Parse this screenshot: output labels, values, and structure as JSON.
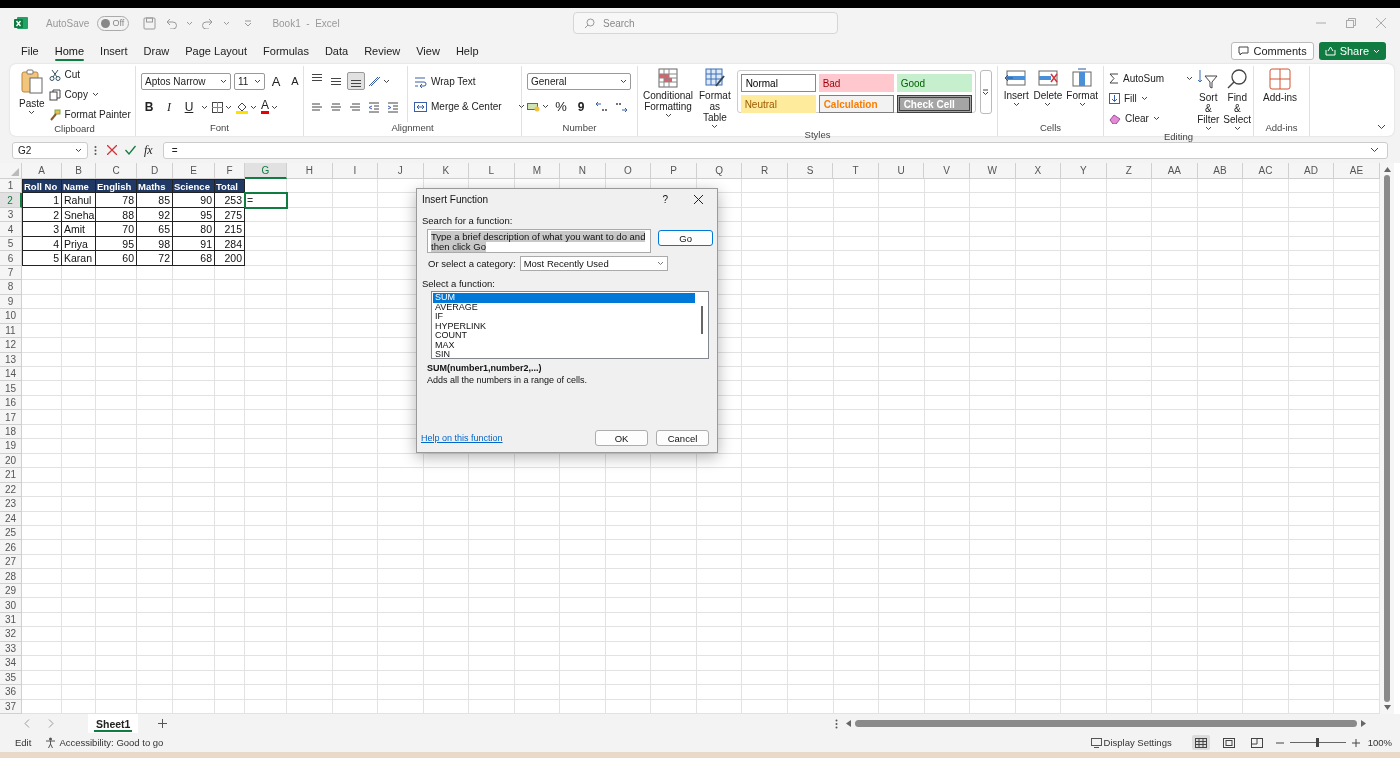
{
  "title_bar": {
    "autosave_label": "AutoSave",
    "autosave_toggle": {
      "label": "Off",
      "on": false
    },
    "title": "Book1  -  Excel",
    "search": {
      "placeholder": "Search"
    }
  },
  "menu_tabs": [
    {
      "label": "File",
      "selected": false
    },
    {
      "label": "Home",
      "selected": true
    },
    {
      "label": "Insert",
      "selected": false
    },
    {
      "label": "Draw",
      "selected": false
    },
    {
      "label": "Page Layout",
      "selected": false
    },
    {
      "label": "Formulas",
      "selected": false
    },
    {
      "label": "Data",
      "selected": false
    },
    {
      "label": "Review",
      "selected": false
    },
    {
      "label": "View",
      "selected": false
    },
    {
      "label": "Help",
      "selected": false
    }
  ],
  "header_buttons": {
    "comments": "Comments",
    "share": "Share"
  },
  "ribbon": {
    "clipboard": {
      "label": "Clipboard",
      "paste": "Paste",
      "cut": "Cut",
      "copy": "Copy",
      "format_painter": "Format Painter"
    },
    "font": {
      "label": "Font",
      "font_name": "Aptos Narrow",
      "font_size": "11",
      "grow_font": "A",
      "shrink_font": "A",
      "bold": "B",
      "italic": "I",
      "underline": "U",
      "font_color": "A"
    },
    "alignment": {
      "label": "Alignment",
      "vertical_align": [
        {
          "selected": false
        },
        {
          "selected": false
        },
        {
          "selected": true
        }
      ],
      "wrap_text": "Wrap Text",
      "merge_center": "Merge & Center"
    },
    "number": {
      "label": "Number",
      "format": "General",
      "percent": "%",
      "comma": "9"
    },
    "styles": {
      "label": "Styles",
      "conditional": "Conditional Formatting",
      "format_table": "Format as Table",
      "gallery": [
        {
          "label": "Normal",
          "kind": "normal"
        },
        {
          "label": "Bad",
          "kind": "bad"
        },
        {
          "label": "Good",
          "kind": "good"
        },
        {
          "label": "Neutral",
          "kind": "neutral"
        },
        {
          "label": "Calculation",
          "kind": "calculation"
        },
        {
          "label": "Check Cell",
          "kind": "check"
        }
      ]
    },
    "cells": {
      "label": "Cells",
      "insert": "Insert",
      "delete": "Delete",
      "format": "Format"
    },
    "editing": {
      "label": "Editing",
      "autosum": "AutoSum",
      "fill": "Fill",
      "clear": "Clear",
      "sort_filter": "Sort & Filter",
      "find_select": "Find & Select"
    },
    "addins": {
      "label": "Add-ins",
      "addins": "Add-ins"
    }
  },
  "formula_bar": {
    "name_box": "G2",
    "fx": "fx",
    "formula": "="
  },
  "sheet": {
    "columns": [
      {
        "label": "A",
        "selected": false
      },
      {
        "label": "B",
        "selected": false
      },
      {
        "label": "C",
        "selected": false
      },
      {
        "label": "D",
        "selected": false
      },
      {
        "label": "E",
        "selected": false
      },
      {
        "label": "F",
        "selected": false
      },
      {
        "label": "G",
        "selected": true
      },
      {
        "label": "H",
        "selected": false
      },
      {
        "label": "I",
        "selected": false
      },
      {
        "label": "J",
        "selected": false
      },
      {
        "label": "K",
        "selected": false
      },
      {
        "label": "L",
        "selected": false
      },
      {
        "label": "M",
        "selected": false
      },
      {
        "label": "N",
        "selected": false
      },
      {
        "label": "O",
        "selected": false
      },
      {
        "label": "P",
        "selected": false
      },
      {
        "label": "Q",
        "selected": false
      },
      {
        "label": "R",
        "selected": false
      },
      {
        "label": "S",
        "selected": false
      },
      {
        "label": "T",
        "selected": false
      },
      {
        "label": "U",
        "selected": false
      },
      {
        "label": "V",
        "selected": false
      },
      {
        "label": "W",
        "selected": false
      },
      {
        "label": "X",
        "selected": false
      },
      {
        "label": "Y",
        "selected": false
      },
      {
        "label": "Z",
        "selected": false
      },
      {
        "label": "AA",
        "selected": false
      },
      {
        "label": "AB",
        "selected": false
      },
      {
        "label": "AC",
        "selected": false
      },
      {
        "label": "AD",
        "selected": false
      },
      {
        "label": "AE",
        "selected": false
      }
    ],
    "rows": [
      {
        "label": "1",
        "selected": false
      },
      {
        "label": "2",
        "selected": true
      },
      {
        "label": "3",
        "selected": false
      },
      {
        "label": "4",
        "selected": false
      },
      {
        "label": "5",
        "selected": false
      },
      {
        "label": "6",
        "selected": false
      },
      {
        "label": "7",
        "selected": false
      },
      {
        "label": "8",
        "selected": false
      },
      {
        "label": "9",
        "selected": false
      },
      {
        "label": "10",
        "selected": false
      },
      {
        "label": "11",
        "selected": false
      },
      {
        "label": "12",
        "selected": false
      },
      {
        "label": "13",
        "selected": false
      },
      {
        "label": "14",
        "selected": false
      },
      {
        "label": "15",
        "selected": false
      },
      {
        "label": "16",
        "selected": false
      },
      {
        "label": "17",
        "selected": false
      },
      {
        "label": "18",
        "selected": false
      },
      {
        "label": "19",
        "selected": false
      },
      {
        "label": "20",
        "selected": false
      },
      {
        "label": "21",
        "selected": false
      },
      {
        "label": "22",
        "selected": false
      },
      {
        "label": "23",
        "selected": false
      },
      {
        "label": "24",
        "selected": false
      },
      {
        "label": "25",
        "selected": false
      },
      {
        "label": "26",
        "selected": false
      },
      {
        "label": "27",
        "selected": false
      },
      {
        "label": "28",
        "selected": false
      },
      {
        "label": "29",
        "selected": false
      },
      {
        "label": "30",
        "selected": false
      },
      {
        "label": "31",
        "selected": false
      },
      {
        "label": "32",
        "selected": false
      },
      {
        "label": "33",
        "selected": false
      },
      {
        "label": "34",
        "selected": false
      },
      {
        "label": "35",
        "selected": false
      },
      {
        "label": "36",
        "selected": false
      },
      {
        "label": "37",
        "selected": false
      }
    ],
    "active_cell_value": "=",
    "table": {
      "columns": [
        {
          "label": "Roll No",
          "kind": "number"
        },
        {
          "label": "Name",
          "kind": "text"
        },
        {
          "label": "English",
          "kind": "number"
        },
        {
          "label": "Maths",
          "kind": "number"
        },
        {
          "label": "Science",
          "kind": "number"
        },
        {
          "label": "Total",
          "kind": "number"
        }
      ],
      "rows": [
        [
          "1",
          "Rahul",
          "78",
          "85",
          "90",
          "253"
        ],
        [
          "2",
          "Sneha",
          "88",
          "92",
          "95",
          "275"
        ],
        [
          "3",
          "Amit",
          "70",
          "65",
          "80",
          "215"
        ],
        [
          "4",
          "Priya",
          "95",
          "98",
          "91",
          "284"
        ],
        [
          "5",
          "Karan",
          "60",
          "72",
          "68",
          "200"
        ]
      ]
    }
  },
  "sheet_tabs": [
    {
      "label": "Sheet1",
      "selected": true
    }
  ],
  "status_bar": {
    "mode": "Edit",
    "accessibility": "Accessibility: Good to go",
    "display_settings": "Display Settings",
    "views": [
      {
        "selected": true
      },
      {
        "selected": false
      },
      {
        "selected": false
      }
    ],
    "zoom": {
      "level": 0.5,
      "reading": "100%"
    }
  },
  "dialog": {
    "title": "Insert Function",
    "help": "?",
    "search_label": "Search for a function:",
    "search_value": "Type a brief description of what you want to do and then click Go",
    "go": "Go",
    "category_label": "Or select a category:",
    "category": "Most Recently Used",
    "function_label": "Select a function:",
    "functions": [
      {
        "label": "SUM",
        "selected": true
      },
      {
        "label": "AVERAGE",
        "selected": false
      },
      {
        "label": "IF",
        "selected": false
      },
      {
        "label": "HYPERLINK",
        "selected": false
      },
      {
        "label": "COUNT",
        "selected": false
      },
      {
        "label": "MAX",
        "selected": false
      },
      {
        "label": "SIN",
        "selected": false
      }
    ],
    "signature": "SUM(number1,number2,...)",
    "description": "Adds all the numbers in a range of cells.",
    "help_link": "Help on this function",
    "ok": "OK",
    "cancel": "Cancel"
  }
}
